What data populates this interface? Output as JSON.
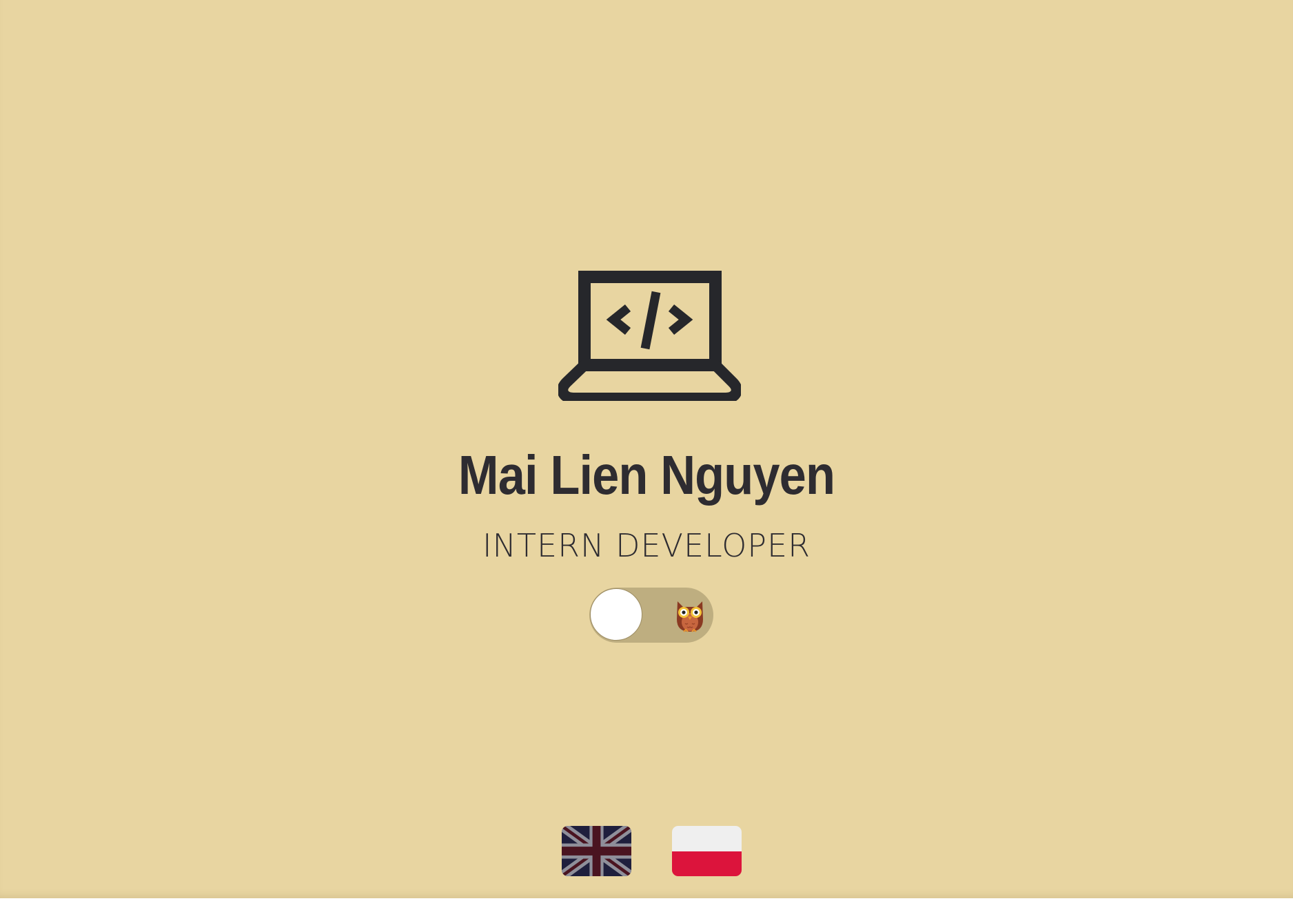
{
  "profile": {
    "name": "Mai Lien Nguyen",
    "role": "INTERN DEVELOPER"
  },
  "icons": {
    "hero": "laptop-code-icon",
    "toggle": "owl-icon"
  },
  "theme_toggle": {
    "state": "off"
  },
  "languages": [
    {
      "icon": "uk-flag-icon"
    },
    {
      "icon": "poland-flag-icon"
    }
  ],
  "colors": {
    "background": "#e8d5a1",
    "text": "#2e2c31",
    "toggle_track": "#beae80",
    "toggle_knob": "#ffffff"
  }
}
